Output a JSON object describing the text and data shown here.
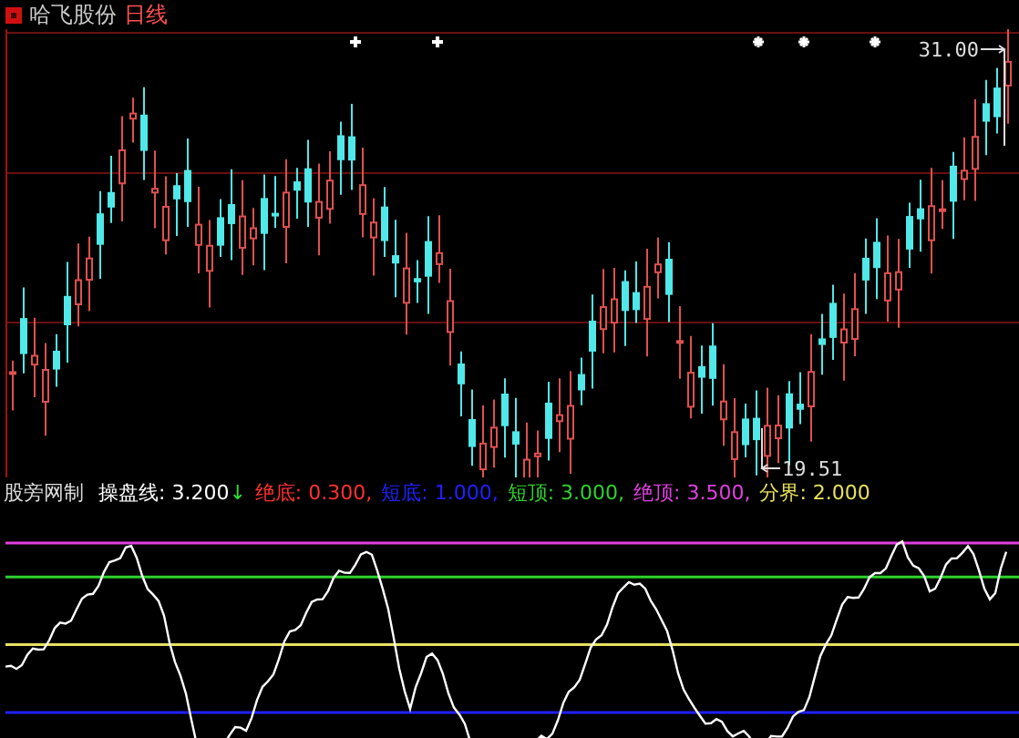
{
  "title": {
    "stock_name": "哈飞股份",
    "period": "日线"
  },
  "price_labels": [
    {
      "kind": "high",
      "text": "31.00"
    },
    {
      "kind": "low",
      "text": "19.51"
    }
  ],
  "indicator": {
    "name": "股旁网制",
    "items": [
      {
        "kind": "main",
        "label": "操盘线:",
        "value": "3.200",
        "arrow": "↓",
        "color": "#ffffff"
      },
      {
        "kind": "threshold",
        "label": "绝底:",
        "value": "0.300,",
        "color": "#ff3030"
      },
      {
        "kind": "threshold",
        "label": "短底:",
        "value": "1.000,",
        "color": "#2020ff"
      },
      {
        "kind": "threshold",
        "label": "短顶:",
        "value": "3.000,",
        "color": "#30d030"
      },
      {
        "kind": "threshold",
        "label": "绝顶:",
        "value": "3.500,",
        "color": "#e040e0"
      },
      {
        "kind": "threshold",
        "label": "分界:",
        "value": "2.000",
        "color": "#e8e060"
      }
    ]
  }
}
